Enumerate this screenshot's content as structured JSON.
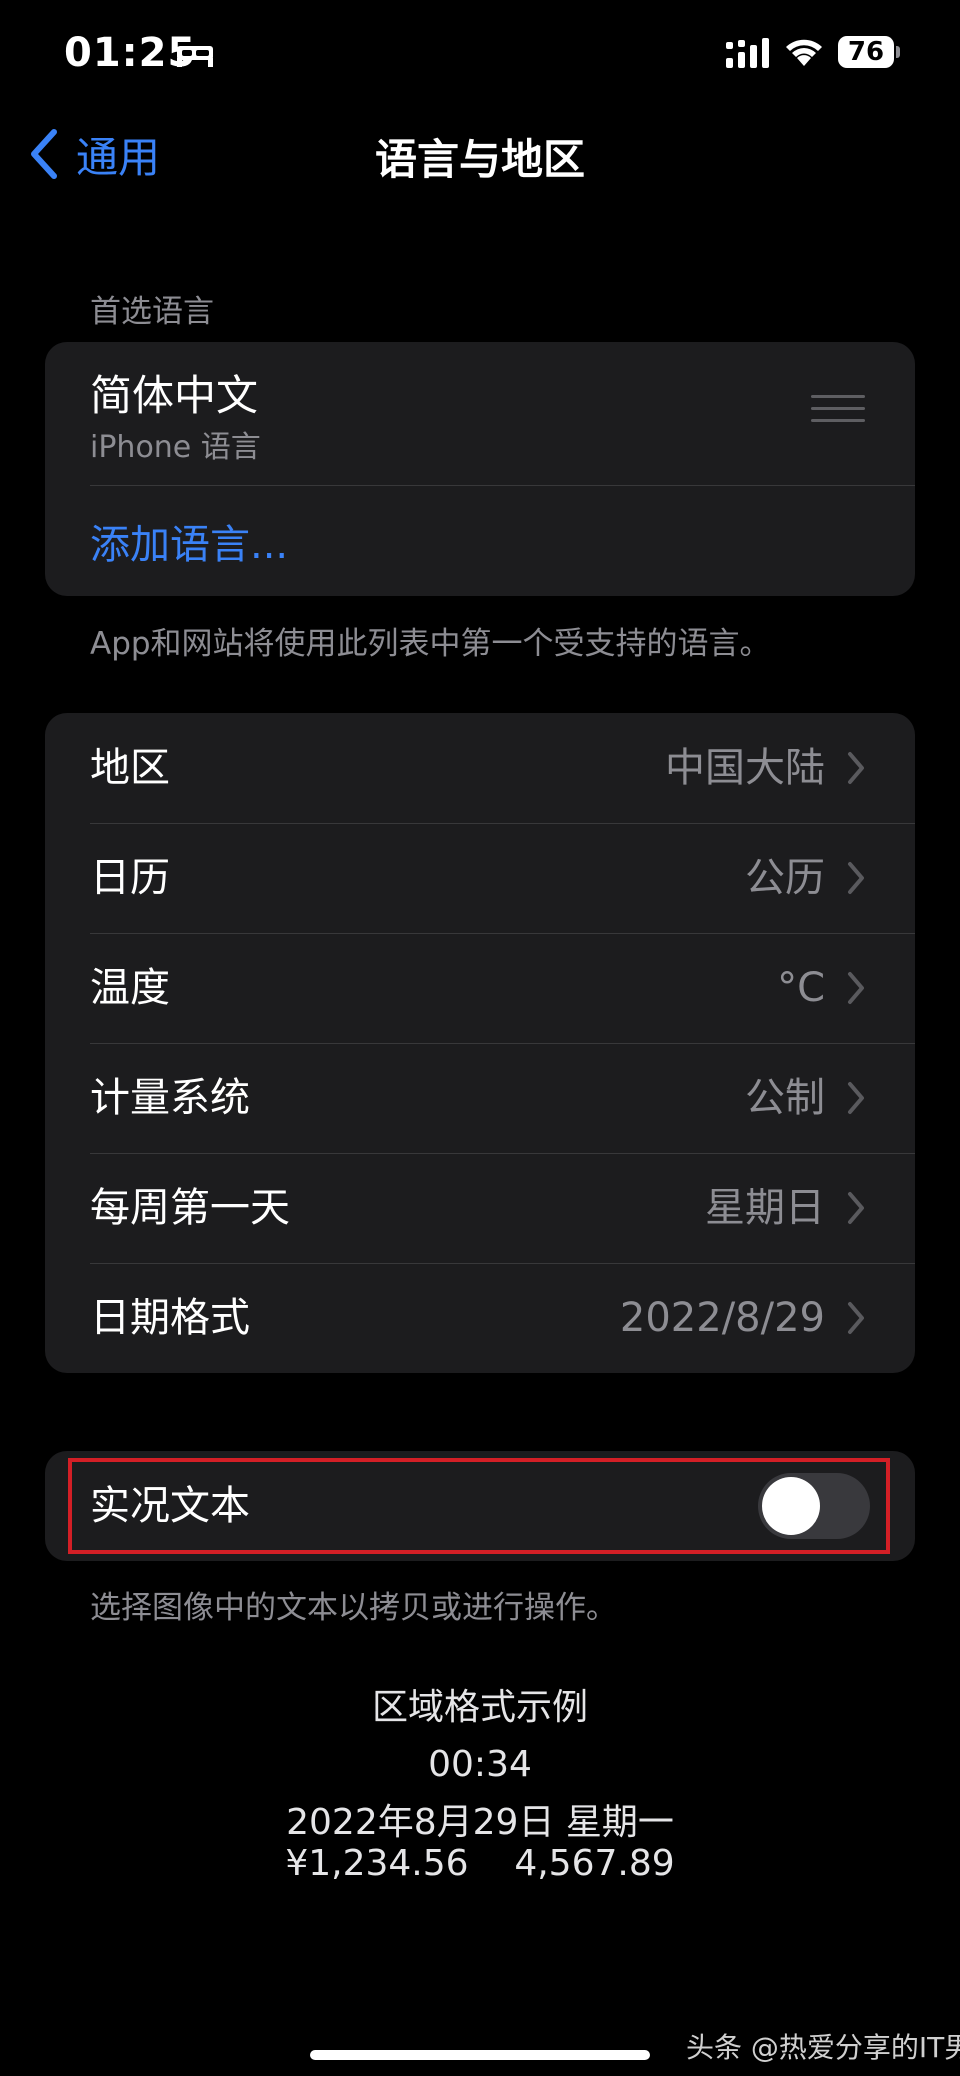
{
  "status_bar": {
    "time": "01:25",
    "battery": "76",
    "icons": [
      "bed-icon",
      "cellular-signal-icon",
      "wifi-icon",
      "battery-icon"
    ]
  },
  "nav": {
    "back_label": "通用",
    "title": "语言与地区"
  },
  "preferred_languages": {
    "header": "首选语言",
    "items": [
      {
        "title": "简体中文",
        "subtitle": "iPhone 语言"
      }
    ],
    "add_label": "添加语言...",
    "footer": "App和网站将使用此列表中第一个受支持的语言。"
  },
  "region_settings": [
    {
      "label": "地区",
      "value": "中国大陆"
    },
    {
      "label": "日历",
      "value": "公历"
    },
    {
      "label": "温度",
      "value": "°C"
    },
    {
      "label": "计量系统",
      "value": "公制"
    },
    {
      "label": "每周第一天",
      "value": "星期日"
    },
    {
      "label": "日期格式",
      "value": "2022/8/29"
    }
  ],
  "live_text": {
    "label": "实况文本",
    "enabled": false,
    "footer": "选择图像中的文本以拷贝或进行操作。"
  },
  "format_example": {
    "title": "区域格式示例",
    "time": "00:34",
    "date": "2022年8月29日 星期一",
    "numbers": "¥1,234.56    4,567.89"
  },
  "watermark": "头条 @热爱分享的IT男",
  "colors": {
    "background": "#000000",
    "group": "#1c1c1e",
    "accent": "#3a82f7",
    "secondary_text": "#8d8d93",
    "highlight": "#d31f26"
  }
}
